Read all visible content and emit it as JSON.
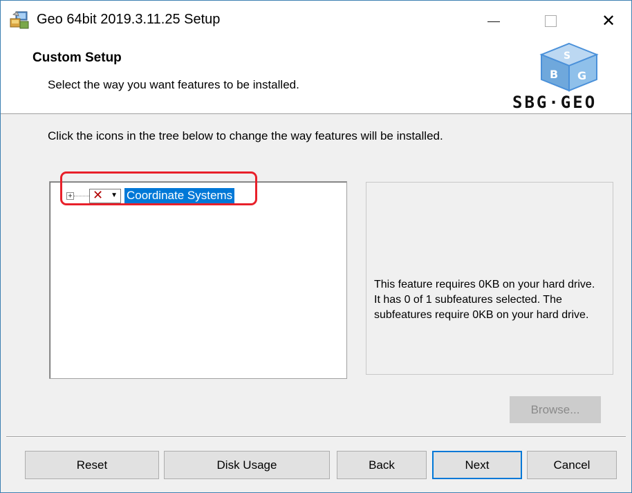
{
  "window": {
    "title": "Geo 64bit 2019.3.11.25 Setup"
  },
  "banner": {
    "title": "Custom Setup",
    "subtitle": "Select the way you want features to be installed.",
    "logo_text": "SBG·GEO"
  },
  "instruction": "Click the icons in the tree below to change the way features will be installed.",
  "tree": {
    "items": [
      {
        "label": "Coordinate Systems",
        "state_icon": "x-icon",
        "expander": "+",
        "selected": true
      }
    ]
  },
  "info": {
    "text": "This feature requires 0KB on your hard drive. It has 0 of 1 subfeatures selected. The subfeatures require 0KB on your hard drive."
  },
  "buttons": {
    "browse": "Browse...",
    "reset": "Reset",
    "disk_usage": "Disk Usage",
    "back": "Back",
    "next": "Next",
    "cancel": "Cancel"
  },
  "colors": {
    "selection": "#0078d7",
    "highlight_box": "#e8202a",
    "logo_blue": "#4a90d9"
  }
}
